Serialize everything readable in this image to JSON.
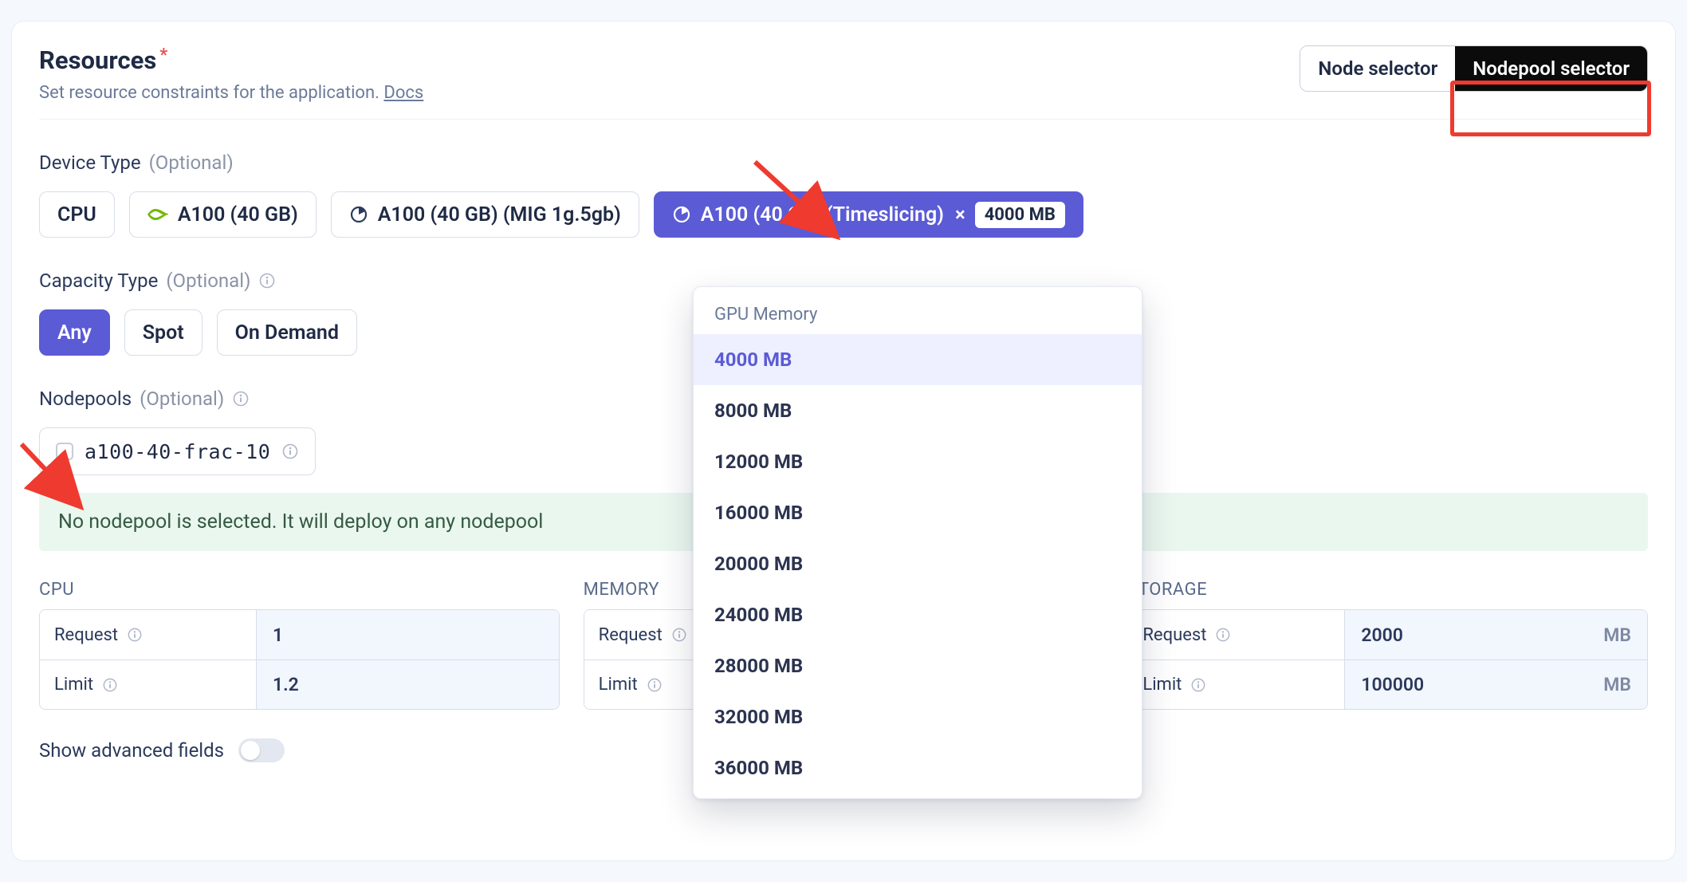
{
  "header": {
    "title": "Resources",
    "required_mark": "*",
    "subtitle_prefix": "Set resource constraints for the application. ",
    "docs_label": "Docs",
    "node_selector_label": "Node selector",
    "nodepool_selector_label": "Nodepool selector"
  },
  "device_type": {
    "label": "Device Type",
    "optional_text": "(Optional)",
    "options": {
      "cpu": "CPU",
      "a100": "A100 (40 GB)",
      "a100_mig": "A100 (40 GB) (MIG 1g.5gb)",
      "a100_ts": "A100 (40 GB) (Timeslicing)"
    },
    "selected_badge": "4000 MB"
  },
  "gpu_memory_dropdown": {
    "title": "GPU Memory",
    "selected": "4000 MB",
    "options": [
      "4000 MB",
      "8000 MB",
      "12000 MB",
      "16000 MB",
      "20000 MB",
      "24000 MB",
      "28000 MB",
      "32000 MB",
      "36000 MB"
    ]
  },
  "capacity_type": {
    "label": "Capacity Type",
    "optional_text": "(Optional)",
    "options": {
      "any": "Any",
      "spot": "Spot",
      "on_demand": "On Demand"
    }
  },
  "nodepools": {
    "label": "Nodepools",
    "optional_text": "(Optional)",
    "chip": "a100-40-frac-10",
    "banner": "No nodepool is selected. It will deploy on any nodepool"
  },
  "resource_table": {
    "cpu_title": "CPU",
    "memory_title": "MEMORY",
    "storage_title": "STORAGE",
    "request_label": "Request",
    "limit_label": "Limit",
    "mb_unit": "MB",
    "cpu_request": "1",
    "cpu_limit": "1.2",
    "storage_request": "2000",
    "storage_limit": "100000"
  },
  "advanced_label": "Show advanced fields"
}
